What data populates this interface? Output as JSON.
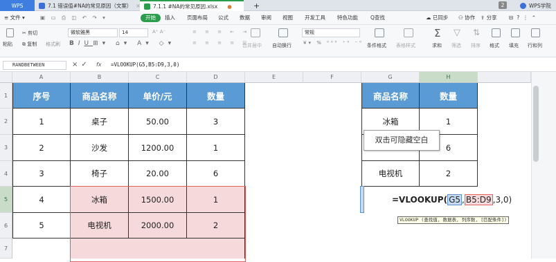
{
  "tabs": {
    "wps": "WPS",
    "doc1": "7.1 错误值#NA的常见原因（文案）",
    "doc2": "7.1.1 #NA的常见原因.xlsx",
    "newtab": "+",
    "right_badge": "2",
    "right_label": "WPS学院"
  },
  "menu": {
    "file": "文件",
    "start": "开始",
    "insert": "插入",
    "layout": "页面布局",
    "formula": "公式",
    "data": "数据",
    "review": "审阅",
    "view": "视图",
    "dev": "开发工具",
    "special": "特色功能",
    "search": "Q查找",
    "sync": "已同步",
    "collab": "协作",
    "share": "分享",
    "help": "?"
  },
  "toolbar": {
    "paste": "粘贴",
    "cut": "剪切",
    "copy": "复制",
    "painter": "格式刷",
    "font": "微软雅黑",
    "size": "14",
    "bold": "B",
    "italic": "I",
    "underline": "U",
    "merge": "合并居中",
    "wrap": "自动换行",
    "numfmt": "常规",
    "condfmt": "条件格式",
    "tablefmt": "表格样式",
    "sum": "求和",
    "filter": "筛选",
    "sort": "排序",
    "format": "格式",
    "fill": "填充",
    "rowcol": "行和列"
  },
  "formula_bar": {
    "namebox": "RANDBETWEEN",
    "fx": "fx",
    "content": "=VLOOKUP(G5,B5:D9,3,0)"
  },
  "columns": [
    "A",
    "B",
    "C",
    "D",
    "E",
    "F",
    "G",
    "H"
  ],
  "rows": [
    "1",
    "2",
    "3",
    "4",
    "5",
    "6",
    "7"
  ],
  "table1": {
    "headers": [
      "序号",
      "商品名称",
      "单价/元",
      "数量"
    ],
    "rows": [
      [
        "1",
        "桌子",
        "50.00",
        "3"
      ],
      [
        "2",
        "沙发",
        "1200.00",
        "1"
      ],
      [
        "3",
        "椅子",
        "20.00",
        "6"
      ],
      [
        "4",
        "冰箱",
        "1500.00",
        "1"
      ],
      [
        "5",
        "电视机",
        "2000.00",
        "2"
      ]
    ]
  },
  "table2": {
    "headers": [
      "商品名称",
      "数量"
    ],
    "rows": [
      [
        "冰箱",
        "1"
      ],
      [
        "",
        "6"
      ],
      [
        "电视机",
        "2"
      ]
    ]
  },
  "tooltip": "双击可隐藏空白",
  "edit": {
    "prefix": "=VLOOKUP(",
    "arg1": "G5",
    "sep1": ", ",
    "arg2": "B5:D9",
    "rest": ",3,0)"
  },
  "hint": "VLOOKUP (查找值, 数据表, 列序数, [匹配条件])",
  "colors": {
    "header": "#5b9bd5",
    "pink": "#f6dadb",
    "active_row": "#c6dbf1",
    "accent": "#2a9d4a"
  }
}
